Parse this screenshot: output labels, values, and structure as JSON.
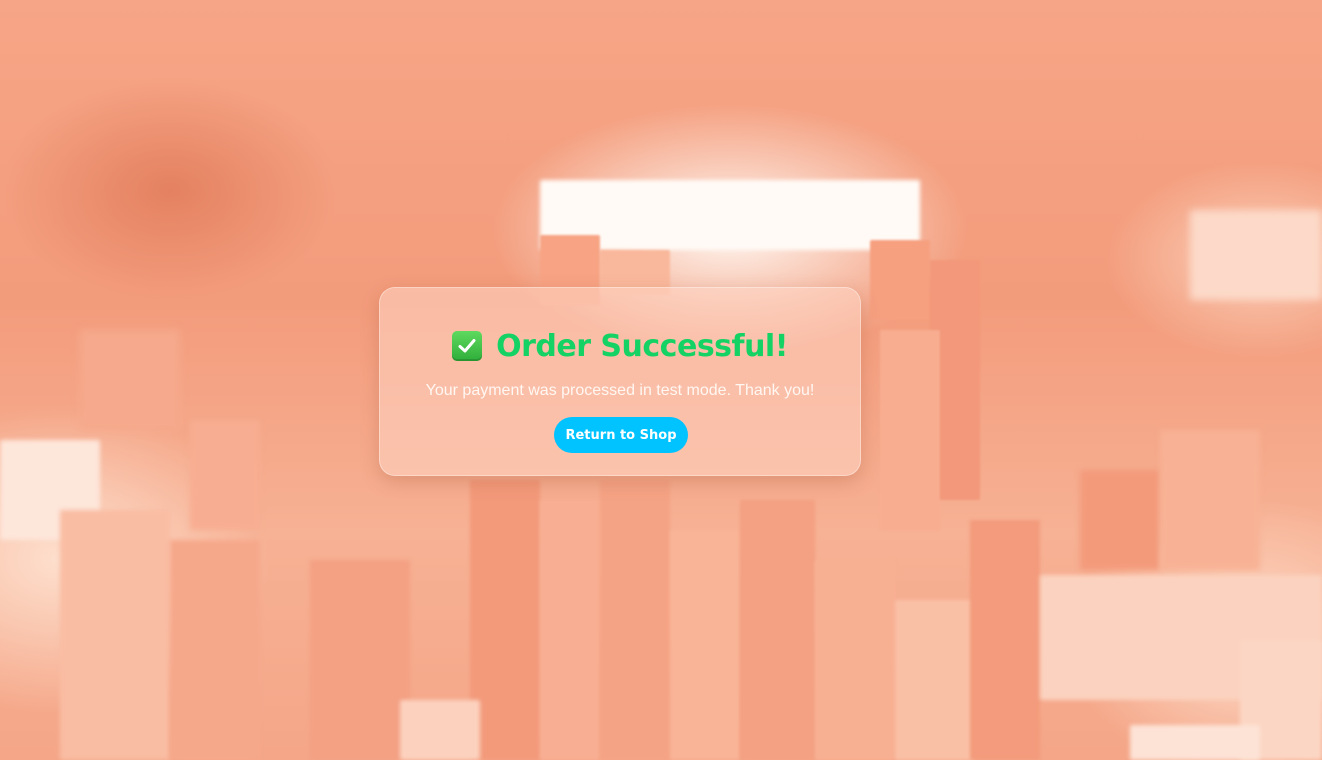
{
  "card": {
    "icon": "check-mark-button-icon",
    "title": "Order Successful!",
    "message": "Your payment was processed in test mode. Thank you!",
    "button_label": "Return to Shop"
  },
  "colors": {
    "title": "#14d264",
    "button": "#00c3ff",
    "button_text": "#ffffff",
    "message_text": "#fff7f2",
    "background": "#f4a283"
  }
}
